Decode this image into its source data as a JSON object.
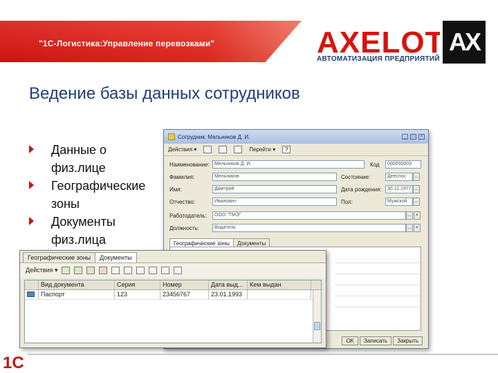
{
  "header": {
    "banner_title": "\"1С-Логистика:Управление перевозками\"",
    "logo_word": "AXELOT",
    "logo_mark": "AX",
    "logo_subtitle": "АВТОМАТИЗАЦИЯ ПРЕДПРИЯТИЙ",
    "brand_color": "#d8140f"
  },
  "slide_title": "Ведение базы данных сотрудников",
  "bullets": [
    {
      "line1": "Данные о",
      "line2": "физ.лице"
    },
    {
      "line1": "Географические",
      "line2": "зоны"
    },
    {
      "line1": "Документы",
      "line2": "физ.лица"
    }
  ],
  "employee_window": {
    "title": "Сотрудник: Мельников Д. И.",
    "toolbar": {
      "actions": "Действия",
      "goto": "Перейти",
      "help": "?"
    },
    "fields": {
      "name_label": "Наименование:",
      "name_value": "Мельников Д. И.",
      "code_label": "Код",
      "code_value": "000000003",
      "surname_label": "Фамилия:",
      "surname_value": "Мельников",
      "status_label": "Состояние:",
      "status_value": "Дееспос",
      "firstname_label": "Имя:",
      "firstname_value": "Дмитрий",
      "birthdate_label": "Дата рождения:",
      "birthdate_value": "30.11.1977",
      "patronymic_label": "Отчество:",
      "patronymic_value": "Иванович",
      "gender_label": "Пол:",
      "gender_value": "Мужской",
      "employer_label": "Работодатель:",
      "employer_value": "ООО \"ТМЭ\"",
      "position_label": "Должность:",
      "position_value": "Водитель"
    },
    "tabs": [
      "Географические зоны",
      "Документы"
    ],
    "buttons": {
      "ok": "OK",
      "save": "Записать",
      "close": "Закрыть"
    }
  },
  "documents_window": {
    "tabs": [
      "Географические зоны",
      "Документы"
    ],
    "toolbar_actions": "Действия",
    "columns": [
      "Вид документа",
      "Серия",
      "Номер",
      "Дата выд...",
      "Кем выдан"
    ],
    "rows": [
      {
        "type": "Паспорт",
        "series": "123",
        "number": "23456767",
        "date": "23.01.1993",
        "issued_by": ""
      }
    ]
  },
  "footer": {
    "mark": "1С"
  }
}
